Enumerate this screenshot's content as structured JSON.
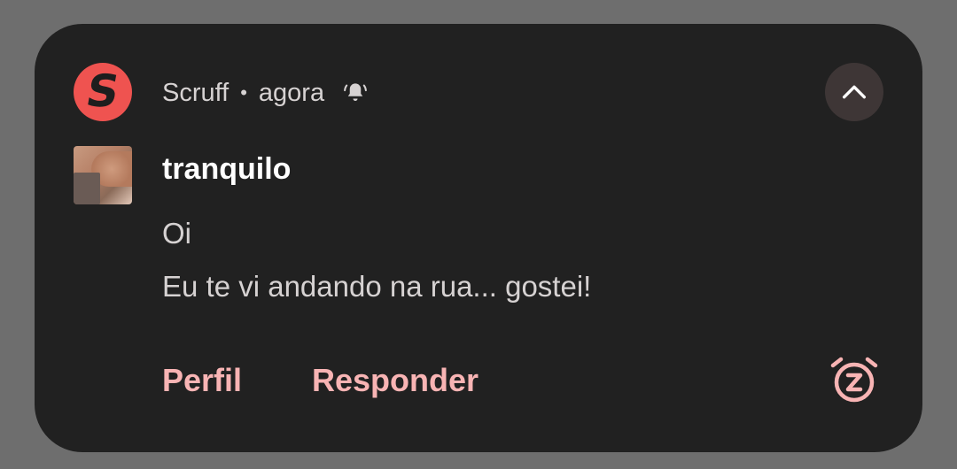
{
  "notification": {
    "app_name": "Scruff",
    "app_icon_letter": "S",
    "separator": "•",
    "time": "agora",
    "sender": "tranquilo",
    "messages": [
      "Oi",
      "Eu te vi andando na rua... gostei!"
    ],
    "actions": {
      "profile": "Perfil",
      "reply": "Responder"
    },
    "icons": {
      "bell": "bell-alert-icon",
      "collapse": "chevron-up-icon",
      "snooze": "snooze-alarm-icon"
    },
    "colors": {
      "card_background": "#212121",
      "app_icon": "#ef5350",
      "action_text": "#f8b4b4"
    }
  }
}
